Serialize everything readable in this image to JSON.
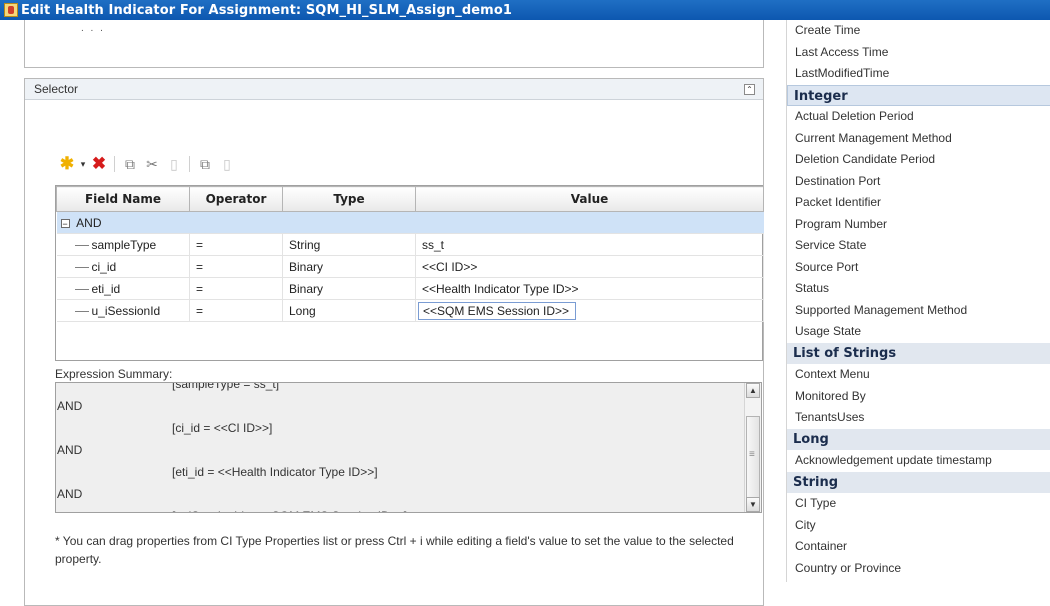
{
  "window": {
    "title": "Edit Health Indicator For Assignment: SQM_HI_SLM_Assign_demo1"
  },
  "top_stub": {
    "text": ". . ."
  },
  "selector": {
    "title": "Selector",
    "collapse_glyph": "⌃",
    "toolbar_icons": [
      "new-icon",
      "dropdown-arrow-icon",
      "delete-icon",
      "copy-icon",
      "cut-icon",
      "paste-icon",
      "duplicate-icon",
      "save-icon"
    ],
    "grid": {
      "columns": [
        "Field Name",
        "Operator",
        "Type",
        "Value"
      ],
      "group": {
        "expander": "−",
        "label": "AND"
      },
      "rows": [
        {
          "field": "sampleType",
          "operator": "=",
          "type": "String",
          "value": "ss_t"
        },
        {
          "field": "ci_id",
          "operator": "=",
          "type": "Binary",
          "value": "<<CI ID>>"
        },
        {
          "field": "eti_id",
          "operator": "=",
          "type": "Binary",
          "value": "<<Health Indicator Type ID>>"
        },
        {
          "field": "u_iSessionId",
          "operator": "=",
          "type": "Long",
          "value": "<<SQM EMS Session ID>>"
        }
      ]
    },
    "expression_summary": {
      "label": "Expression Summary:",
      "lines": [
        {
          "kind": "ind",
          "text": "[sampleType = ss_t]"
        },
        {
          "kind": "and",
          "text": "AND"
        },
        {
          "kind": "ind",
          "text": "[ci_id = <<CI ID>>]"
        },
        {
          "kind": "and",
          "text": "AND"
        },
        {
          "kind": "ind",
          "text": "[eti_id = <<Health Indicator Type ID>>]"
        },
        {
          "kind": "and",
          "text": "AND"
        },
        {
          "kind": "ind",
          "text": "[u_iSessionId = <<SQM EMS Session ID>>]"
        }
      ]
    },
    "help_text": "* You can drag properties from CI Type Properties list or press Ctrl + i while editing a field's value to set the value to the selected property."
  },
  "properties_panel": {
    "items": [
      {
        "kind": "item",
        "label": "Create Time"
      },
      {
        "kind": "item",
        "label": "Last Access Time"
      },
      {
        "kind": "item",
        "label": "LastModifiedTime"
      },
      {
        "kind": "cat",
        "label": "Integer",
        "selected": true
      },
      {
        "kind": "item",
        "label": "Actual Deletion Period"
      },
      {
        "kind": "item",
        "label": "Current Management Method"
      },
      {
        "kind": "item",
        "label": "Deletion Candidate Period"
      },
      {
        "kind": "item",
        "label": "Destination Port"
      },
      {
        "kind": "item",
        "label": "Packet Identifier"
      },
      {
        "kind": "item",
        "label": "Program Number"
      },
      {
        "kind": "item",
        "label": "Service State"
      },
      {
        "kind": "item",
        "label": "Source Port"
      },
      {
        "kind": "item",
        "label": "Status"
      },
      {
        "kind": "item",
        "label": "Supported Management Method"
      },
      {
        "kind": "item",
        "label": "Usage State"
      },
      {
        "kind": "cat",
        "label": "List of Strings"
      },
      {
        "kind": "item",
        "label": "Context Menu"
      },
      {
        "kind": "item",
        "label": "Monitored By"
      },
      {
        "kind": "item",
        "label": "TenantsUses"
      },
      {
        "kind": "cat",
        "label": "Long"
      },
      {
        "kind": "item",
        "label": "Acknowledgement update timestamp"
      },
      {
        "kind": "cat",
        "label": "String"
      },
      {
        "kind": "item",
        "label": "CI Type"
      },
      {
        "kind": "item",
        "label": "City"
      },
      {
        "kind": "item",
        "label": "Container"
      },
      {
        "kind": "item",
        "label": "Country or Province"
      }
    ]
  }
}
